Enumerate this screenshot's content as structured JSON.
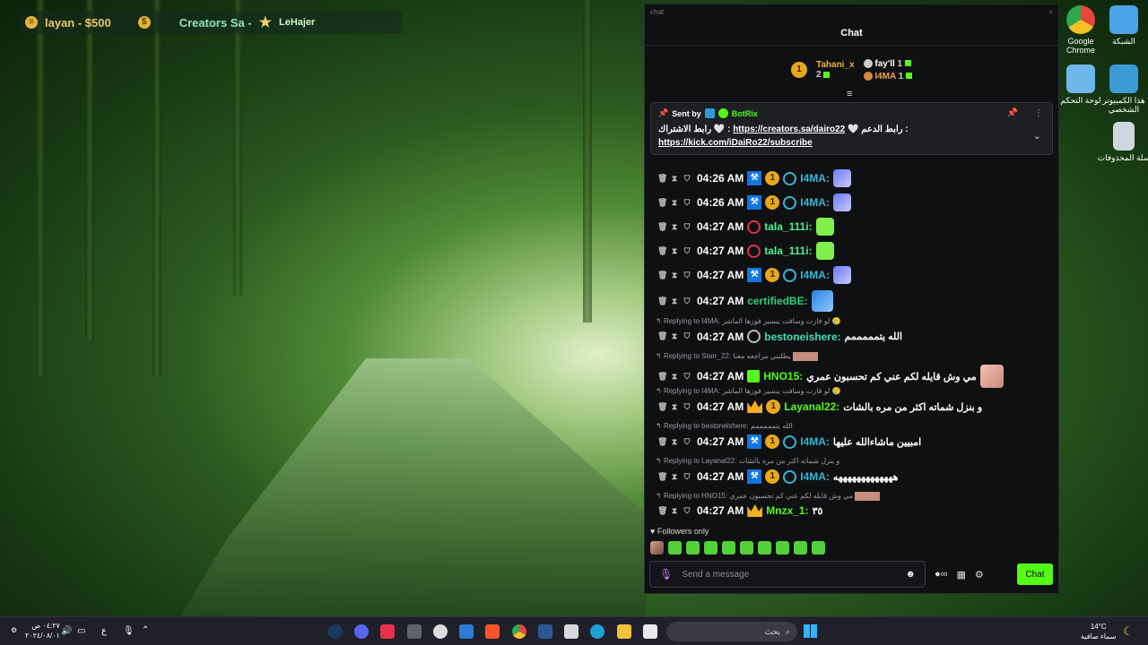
{
  "stream_bar": {
    "goal_text": "layan - $500",
    "creators_text": "Creators Sa -",
    "supporter_name": "LeHajer"
  },
  "desktop_icons": [
    {
      "label": "Google Chrome",
      "color": "#e8453c"
    },
    {
      "label": "الشبكة",
      "color": "#4aa3e6"
    },
    {
      "label": "لوحة التحكم",
      "color": "#6fb7e8"
    },
    {
      "label": "هذا الكمبيوتر الشخصي",
      "color": "#3c9ad6"
    },
    {
      "label": "سلة المحذوفات",
      "color": "#d0d6de"
    }
  ],
  "chat": {
    "window_title": "chat",
    "close_glyph": "×",
    "header": "Chat",
    "leaderboard": {
      "first": {
        "rank": "1",
        "name": "Tahani_x",
        "count": "2"
      },
      "second": {
        "name": "fay'll",
        "count": "1"
      },
      "third": {
        "name": "I4MA",
        "count": "1"
      }
    },
    "pinned": {
      "sent_by": "Sent by",
      "bot_name": "BotRix",
      "line1_prefix": "رابط الاشتراك 🤍 :",
      "link1": "https://creators.sa/dairo22",
      "line1_suffix": "🤍 رابط الدعم :",
      "link2": "https://kick.com/iDaiRo22/subscribe"
    },
    "messages": [
      {
        "time": "04:26 AM",
        "user": "I4MA:",
        "user_color": "#39b6d6",
        "text": ""
      },
      {
        "time": "04:26 AM",
        "user": "I4MA:",
        "user_color": "#39b6d6",
        "text": ""
      },
      {
        "time": "04:27 AM",
        "user": "tala_111i:",
        "user_color": "#4ef08a",
        "text": ""
      },
      {
        "time": "04:27 AM",
        "user": "tala_111i:",
        "user_color": "#4ef08a",
        "text": ""
      },
      {
        "time": "04:27 AM",
        "user": "I4MA:",
        "user_color": "#39b6d6",
        "text": ""
      },
      {
        "time": "04:27 AM",
        "user": "certifiedBE:",
        "user_color": "#2fd07a",
        "text": ""
      },
      {
        "reply_to": "Replying to I4MA: لو فازت وسافت يبسير فوزها الماشر 🥲",
        "time": "04:27 AM",
        "user": "bestoneishere:",
        "user_color": "#3fe0b0",
        "text": "الله يتمممممم"
      },
      {
        "reply_to": "Replying to Starr_22: يطلبني مراجعه معنا",
        "time": "04:27 AM",
        "user": "HNO15:",
        "user_color": "#53fc18",
        "text": "مي وش قايله لكم عني كم تحسبون عمري"
      },
      {
        "reply_to": "Replying to I4MA: لو فازت وسافت يبسير فوزها الماشر 🥲",
        "time": "04:27 AM",
        "user": "Layanal22:",
        "user_color": "#53fc18",
        "text": "و بنزل شماته اكثر من مره بالشات"
      },
      {
        "reply_to": "Replying to bestoneishere: الله يتمممممم",
        "time": "04:27 AM",
        "user": "I4MA:",
        "user_color": "#39b6d6",
        "text": "امبيين ماشاءالله عليها"
      },
      {
        "reply_to": "Replying to Layanal22: و بنزل شماته اكثر من مره بالشات",
        "time": "04:27 AM",
        "user": "I4MA:",
        "user_color": "#39b6d6",
        "text": "هههههههههههههه"
      },
      {
        "reply_to": "Replying to HNO15: مي وش قايله لكم عني كم تحسبون عمري",
        "time": "04:27 AM",
        "user": "Mnzx_1:",
        "user_color": "#53fc18",
        "text": "٣٥"
      }
    ],
    "followers_only": "Followers only",
    "input_placeholder": "Send a message",
    "chat_button": "Chat"
  },
  "taskbar": {
    "search_placeholder": "بحث",
    "weather_temp": "14°C",
    "weather_desc": "سماء صافية",
    "clock_time": "٠٤:٢٧ ص",
    "clock_date": "٢٠٢٤/٠٨/٠١",
    "lang": "ع"
  },
  "colors": {
    "kick_green": "#53fc18",
    "chat_bg": "#0f1012"
  }
}
